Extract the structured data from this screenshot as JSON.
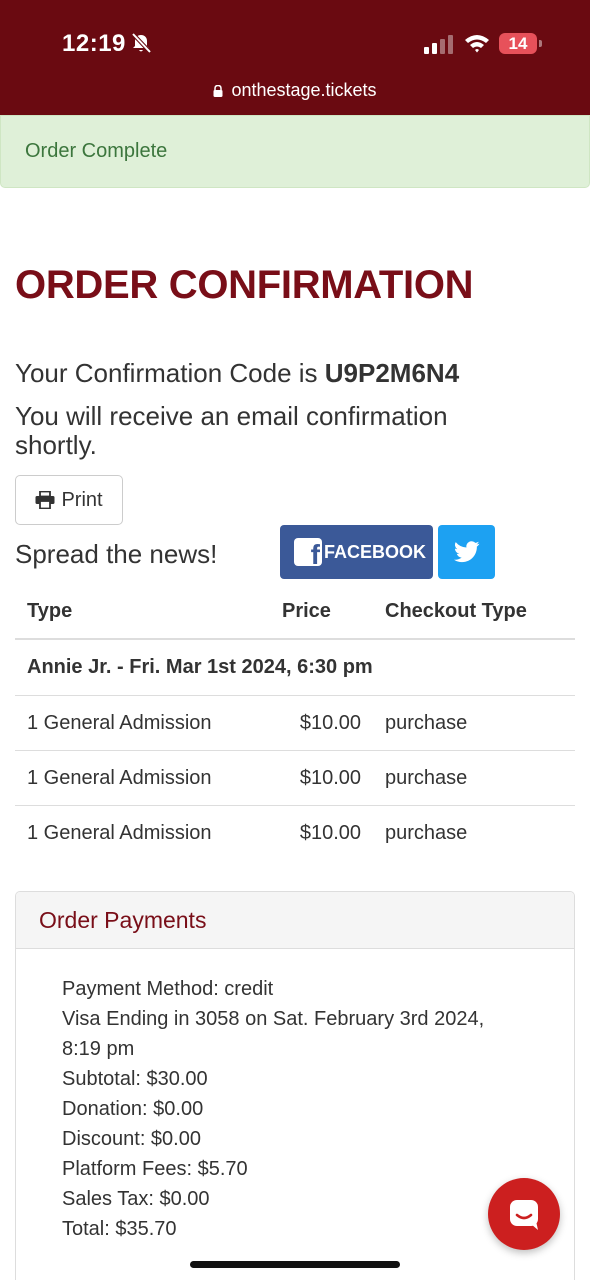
{
  "status_bar": {
    "time": "12:19",
    "battery": "14",
    "url": "onthestage.tickets"
  },
  "alert": {
    "text": "Order Complete"
  },
  "page": {
    "title": "ORDER CONFIRMATION",
    "code_prefix": "Your Confirmation Code is ",
    "code": "U9P2M6N4",
    "email_notice": "You will receive an email confirmation shortly.",
    "print_label": "Print",
    "spread_label": "Spread the news!",
    "facebook_label": "FACEBOOK"
  },
  "tickets": {
    "headers": {
      "type": "Type",
      "price": "Price",
      "checkout": "Checkout Type"
    },
    "group": "Annie Jr. - Fri. Mar 1st 2024, 6:30 pm",
    "rows": [
      {
        "type": "1 General Admission",
        "price": "$10.00",
        "checkout": "purchase"
      },
      {
        "type": "1 General Admission",
        "price": "$10.00",
        "checkout": "purchase"
      },
      {
        "type": "1 General Admission",
        "price": "$10.00",
        "checkout": "purchase"
      }
    ]
  },
  "payments": {
    "title": "Order Payments",
    "method": "Payment Method: credit",
    "card": "Visa Ending in 3058 on Sat. February 3rd 2024, 8:19 pm",
    "subtotal": "Subtotal: $30.00",
    "donation": "Donation: $0.00",
    "discount": "Discount: $0.00",
    "platform_fees": "Platform Fees: $5.70",
    "sales_tax": "Sales Tax: $0.00",
    "total": "Total: $35.70"
  },
  "colors": {
    "brand": "#6a0a11",
    "title": "#790e18",
    "alert_bg": "#dff0d8",
    "alert_text": "#3c763d",
    "facebook": "#3b5998",
    "twitter": "#1da1f2",
    "chat": "#cc1f1f"
  },
  "icons": [
    "bell-muted-icon",
    "signal-icon",
    "wifi-icon",
    "battery-icon",
    "lock-icon",
    "printer-icon",
    "facebook-icon",
    "twitter-icon",
    "chat-icon"
  ]
}
